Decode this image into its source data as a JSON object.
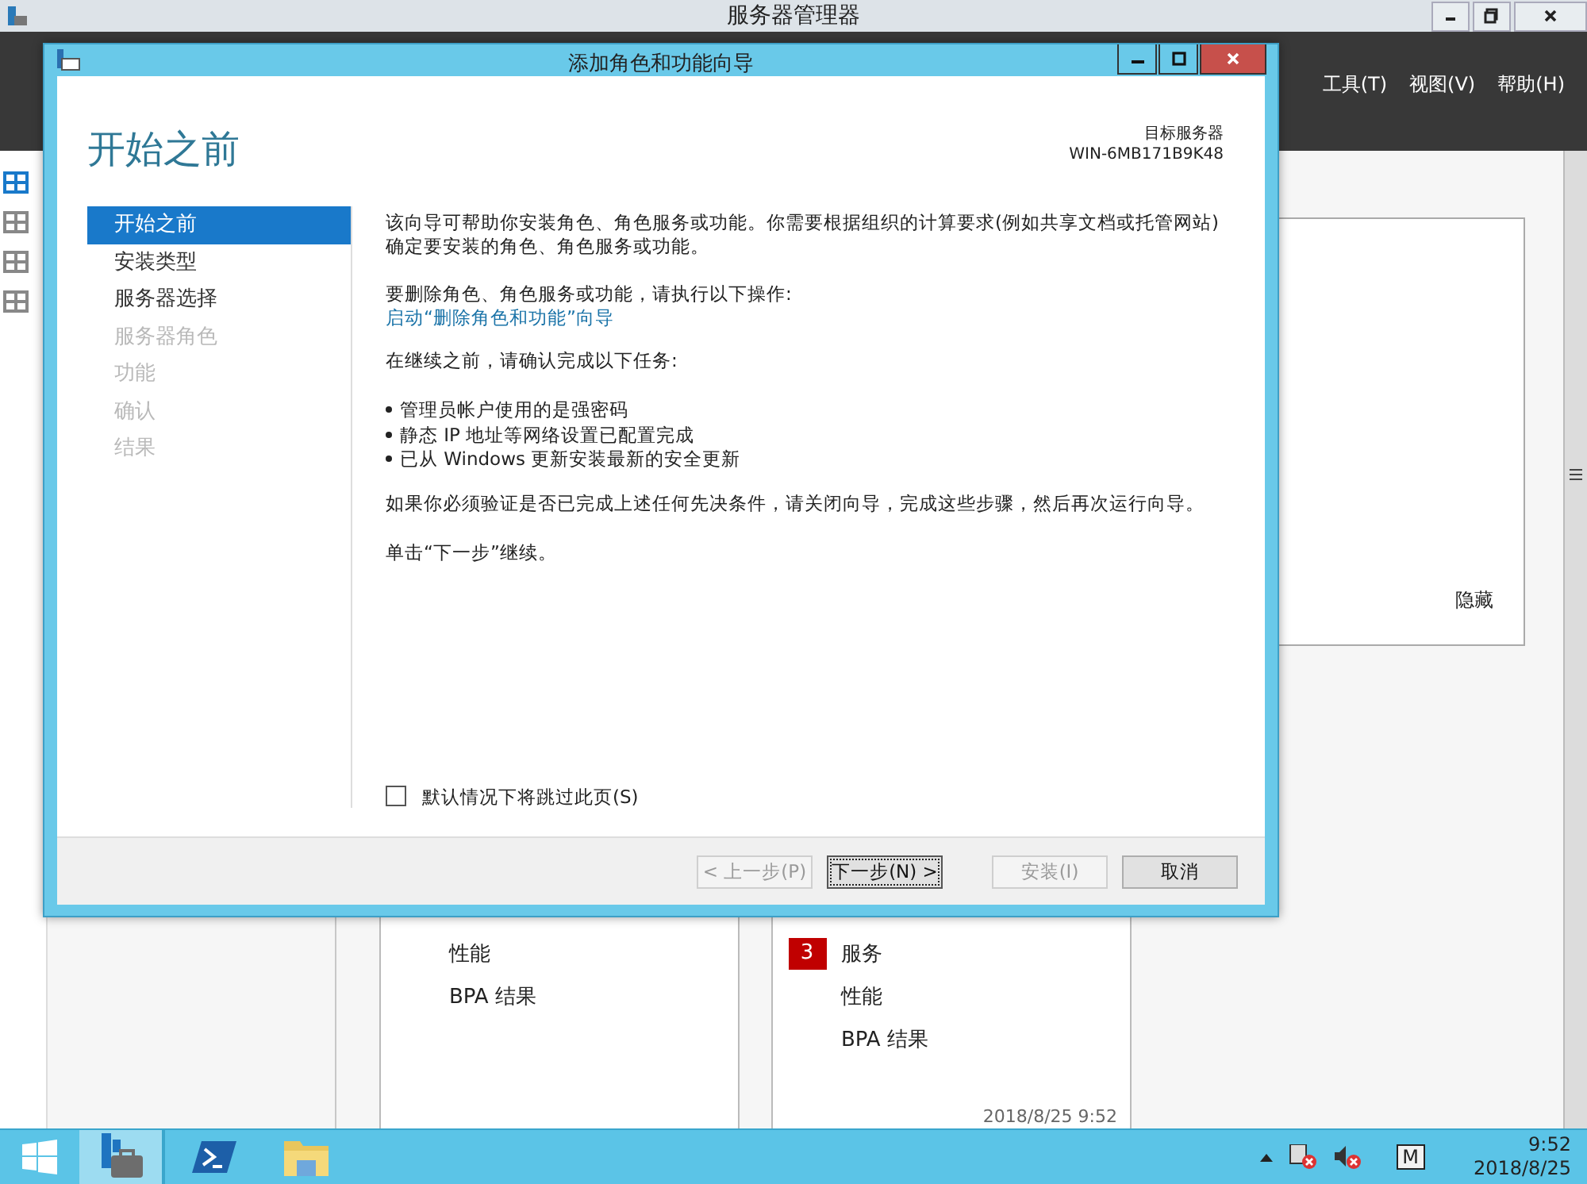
{
  "server_manager": {
    "title": "服务器管理器",
    "menu": [
      "工具(T)",
      "视图(V)",
      "帮助(H)"
    ],
    "nav_icons": [
      {
        "selected": true
      },
      {
        "selected": false
      },
      {
        "selected": false
      },
      {
        "selected": false
      }
    ],
    "hide_link": "隐藏",
    "tiles": [
      {
        "rows": [
          {
            "label": "性能"
          },
          {
            "label": "BPA 结果"
          }
        ]
      },
      {
        "rows": [
          {
            "badge": "3",
            "label": "服务"
          },
          {
            "label": "性能"
          },
          {
            "label": "BPA 结果"
          }
        ],
        "timestamp": "2018/8/25 9:52"
      }
    ]
  },
  "dialog": {
    "title": "添加角色和功能向导",
    "heading": "开始之前",
    "target_label": "目标服务器",
    "target_server": "WIN-6MB171B9K48",
    "nav": [
      {
        "label": "开始之前",
        "selected": true,
        "disabled": false
      },
      {
        "label": "安装类型",
        "selected": false,
        "disabled": false
      },
      {
        "label": "服务器选择",
        "selected": false,
        "disabled": false
      },
      {
        "label": "服务器角色",
        "selected": false,
        "disabled": true
      },
      {
        "label": "功能",
        "selected": false,
        "disabled": true
      },
      {
        "label": "确认",
        "selected": false,
        "disabled": true
      },
      {
        "label": "结果",
        "selected": false,
        "disabled": true
      }
    ],
    "intro": "该向导可帮助你安装角色、角色服务或功能。你需要根据组织的计算要求(例如共享文档或托管网站)确定要安装的角色、角色服务或功能。",
    "remove_prompt": "要删除角色、角色服务或功能，请执行以下操作:",
    "remove_link": "启动“删除角色和功能”向导",
    "before_prompt": "在继续之前，请确认完成以下任务:",
    "tasks": [
      "管理员帐户使用的是强密码",
      "静态 IP 地址等网络设置已配置完成",
      "已从 Windows 更新安装最新的安全更新"
    ],
    "note": "如果你必须验证是否已完成上述任何先决条件，请关闭向导，完成这些步骤，然后再次运行向导。",
    "continue_hint": "单击“下一步”继续。",
    "skip_checkbox": {
      "label": "默认情况下将跳过此页(S)",
      "checked": false
    },
    "buttons": [
      {
        "label": "< 上一步(P)",
        "disabled": true,
        "focused": false
      },
      {
        "label": "下一步(N) >",
        "disabled": false,
        "focused": true
      },
      {
        "label": "安装(I)",
        "disabled": true,
        "focused": false
      },
      {
        "label": "取消",
        "disabled": false,
        "focused": false
      }
    ]
  },
  "taskbar": {
    "apps": [
      {
        "kind": "server-manager",
        "selected": true
      },
      {
        "kind": "powershell",
        "selected": false
      },
      {
        "kind": "explorer",
        "selected": false
      }
    ],
    "tray": {
      "ime": "M",
      "time": "9:52",
      "date": "2018/8/25"
    }
  }
}
